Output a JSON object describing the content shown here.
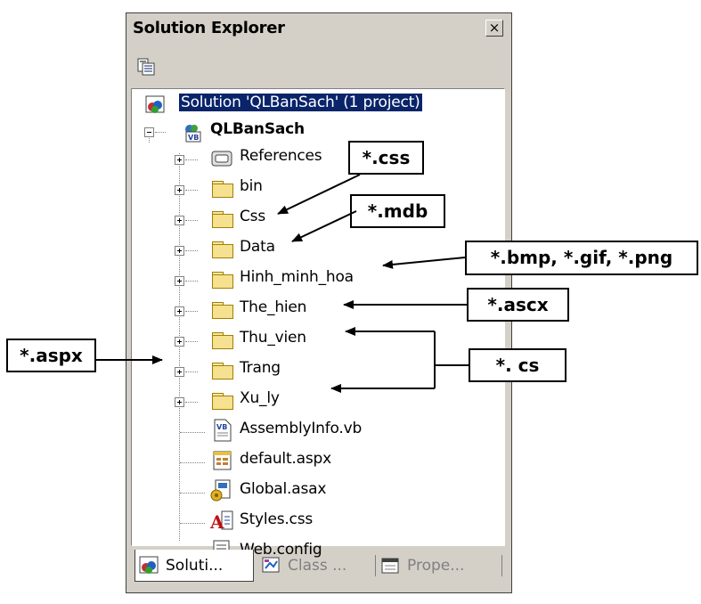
{
  "panel": {
    "title": "Solution Explorer",
    "close_glyph": "×"
  },
  "tree": {
    "solution_label": "Solution 'QLBanSach' (1 project)",
    "project_label": "QLBanSach",
    "items": [
      {
        "label": "References",
        "icon": "references-icon",
        "expandable": true
      },
      {
        "label": "bin",
        "icon": "folder-icon",
        "expandable": true
      },
      {
        "label": "Css",
        "icon": "folder-icon",
        "expandable": true
      },
      {
        "label": "Data",
        "icon": "folder-icon",
        "expandable": true
      },
      {
        "label": "Hinh_minh_hoa",
        "icon": "folder-icon",
        "expandable": true
      },
      {
        "label": "The_hien",
        "icon": "folder-icon",
        "expandable": true
      },
      {
        "label": "Thu_vien",
        "icon": "folder-icon",
        "expandable": true
      },
      {
        "label": "Trang",
        "icon": "folder-icon",
        "expandable": true
      },
      {
        "label": "Xu_ly",
        "icon": "folder-icon",
        "expandable": true
      },
      {
        "label": "AssemblyInfo.vb",
        "icon": "vb-file-icon",
        "expandable": false
      },
      {
        "label": "default.aspx",
        "icon": "aspx-file-icon",
        "expandable": false
      },
      {
        "label": "Global.asax",
        "icon": "asax-file-icon",
        "expandable": false
      },
      {
        "label": "Styles.css",
        "icon": "css-file-icon",
        "expandable": false
      },
      {
        "label": "Web.config",
        "icon": "config-file-icon",
        "expandable": false
      }
    ]
  },
  "tabs": [
    {
      "label": "Soluti...",
      "icon": "solution-explorer-icon",
      "active": true
    },
    {
      "label": "Class ...",
      "icon": "class-view-icon",
      "active": false
    },
    {
      "label": "Prope...",
      "icon": "properties-icon",
      "active": false
    }
  ],
  "callouts": {
    "css": "*.css",
    "mdb": "*.mdb",
    "images": "*.bmp, *.gif, *.png",
    "ascx": "*.ascx",
    "cs": "*. cs",
    "aspx": "*.aspx"
  },
  "colors": {
    "panel_bg": "#d4d0c8",
    "selection_bg": "#0a246a",
    "folder_fill": "#f6e190"
  }
}
